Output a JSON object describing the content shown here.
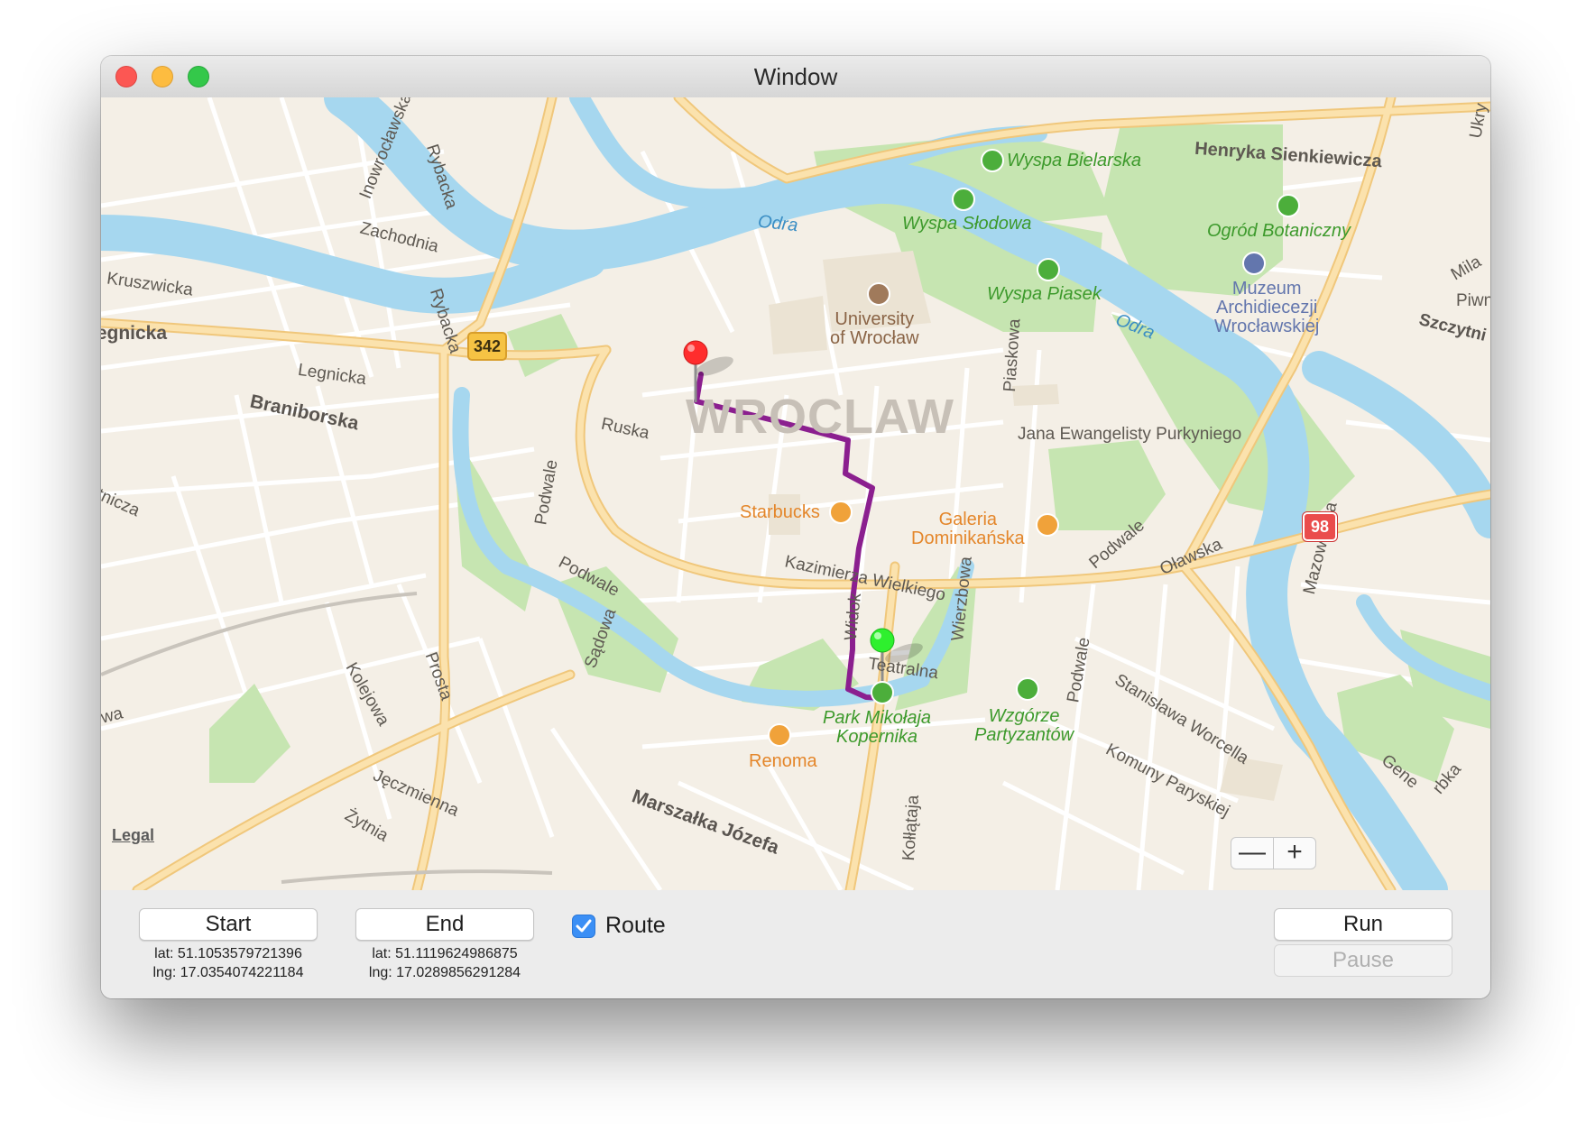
{
  "window": {
    "title": "Window"
  },
  "map": {
    "city": "WROCLAW",
    "legal": "Legal",
    "zoom_out": "—",
    "zoom_in": "+",
    "water": [
      "Odra",
      "Odra"
    ],
    "roads": [
      "Henryka Sienkiewicza",
      "Inowrocławska",
      "Rybacka",
      "Zachodnia",
      "Kruszwicka",
      "Legnicka",
      "Legnicka",
      "Rybacka",
      "Braniborska",
      "Ruska",
      "Podwale",
      "Podwale",
      "Podwale",
      "Podwale",
      "Sądowa",
      "Kazimierza Wielkiego",
      "Widok",
      "Teatralna",
      "Wierzbowa",
      "Piaskowa",
      "Jana Ewangelisty Purkyniego",
      "Oławska",
      "Mazowiecka",
      "Prosta",
      "Kolejowa",
      "Stanisława Worcella",
      "Komuny Paryskiej",
      "Jęczmienna",
      "Żytnia",
      "Marszałka Józefa",
      "Kołłątaja",
      "Szczytni",
      "Piwn",
      "Mila",
      "Ukry",
      "Gene",
      "rbka",
      "tnicza",
      "wa"
    ],
    "highways": [
      "342",
      "98"
    ],
    "poi": {
      "starbucks": "Starbucks",
      "galeria": "Galeria\nDominikańska",
      "renoma": "Renoma",
      "university": "University\nof Wrocław",
      "museum": "Muzeum\nArchidiecezji\nWrocławskiej"
    },
    "parks": {
      "bielarska": "Wyspa Bielarska",
      "slodowa": "Wyspa Słodowa",
      "piasek": "Wyspa Piasek",
      "ogrod": "Ogród Botaniczny",
      "kopernika": "Park Mikołaja\nKopernika",
      "partyzantow": "Wzgórze\nPartyzantów"
    },
    "colors": {
      "route": "#8b1f8f",
      "start_pin": "#ff2d2d",
      "end_pin": "#2ef02e",
      "water": "#a6d7ef",
      "park": "#c6e5b1",
      "road_major": "#f7d896",
      "land": "#f4efe6"
    }
  },
  "controls": {
    "start_label": "Start",
    "start_lat": "lat: 51.1053579721396",
    "start_lng": "lng: 17.0354074221184",
    "end_label": "End",
    "end_lat": "lat: 51.1119624986875",
    "end_lng": "lng: 17.0289856291284",
    "route_label": "Route",
    "route_checked": true,
    "run_label": "Run",
    "pause_label": "Pause"
  }
}
